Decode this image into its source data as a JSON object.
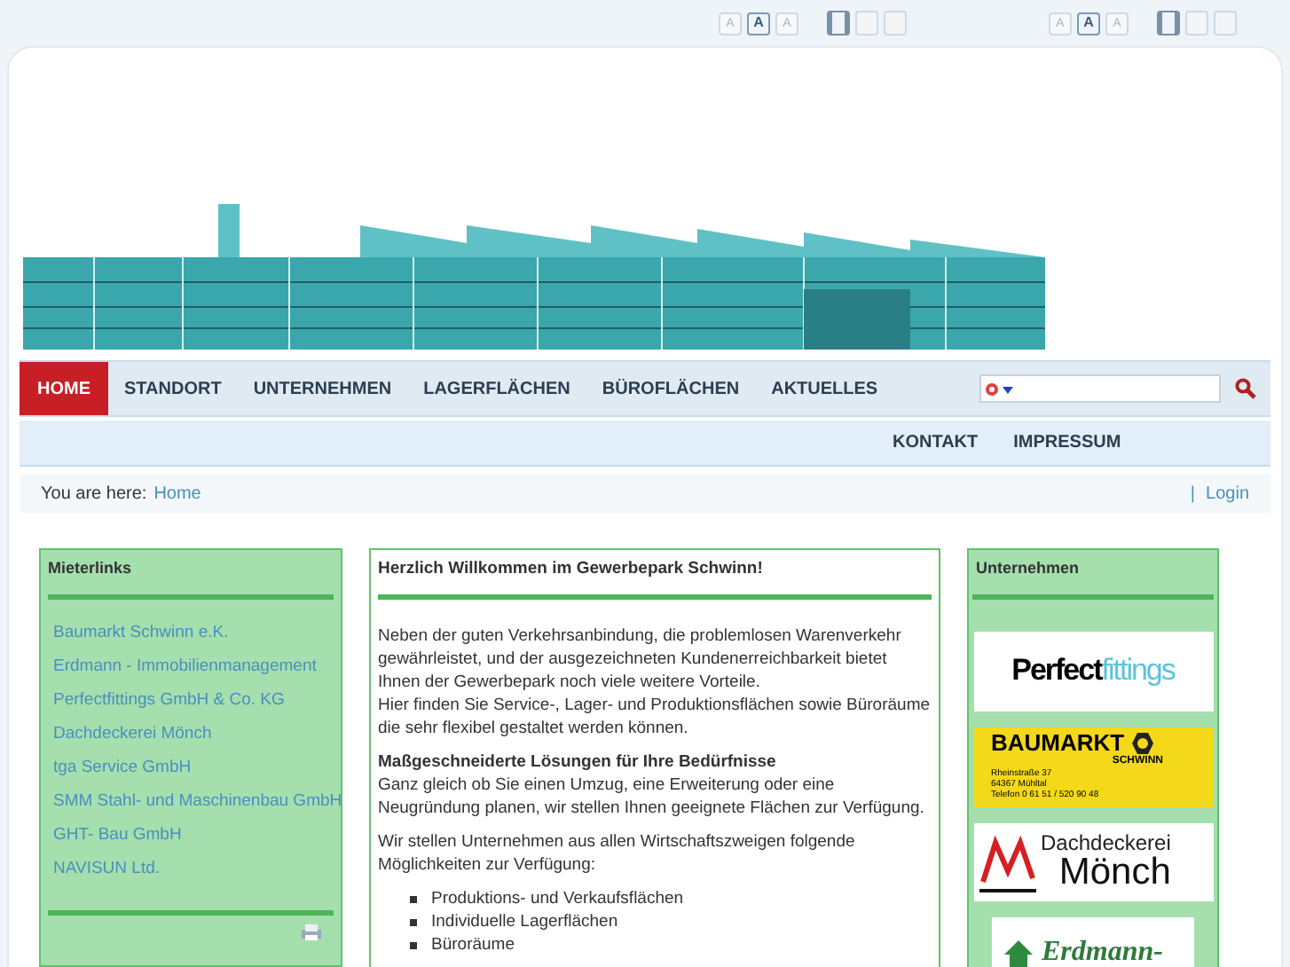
{
  "accessibility_bars": [
    {
      "font_sizes": [
        {
          "label": "A",
          "selected": false
        },
        {
          "label": "A",
          "selected": true
        },
        {
          "label": "A",
          "selected": false
        }
      ],
      "widths": [
        {
          "selected": true
        },
        {
          "selected": false
        },
        {
          "selected": false
        }
      ]
    },
    {
      "font_sizes": [
        {
          "label": "A",
          "selected": false
        },
        {
          "label": "A",
          "selected": true
        },
        {
          "label": "A",
          "selected": false
        }
      ],
      "widths": [
        {
          "selected": true
        },
        {
          "selected": false
        },
        {
          "selected": false
        }
      ]
    }
  ],
  "main_nav": [
    {
      "label": "HOME",
      "selected": true
    },
    {
      "label": "STANDORT",
      "selected": false
    },
    {
      "label": "UNTERNEHMEN",
      "selected": false
    },
    {
      "label": "LAGERFLÄCHEN",
      "selected": false
    },
    {
      "label": "BÜROFLÄCHEN",
      "selected": false
    },
    {
      "label": "AKTUELLES",
      "selected": false
    }
  ],
  "secondary_nav": [
    "KONTAKT",
    "IMPRESSUM"
  ],
  "breadcrumb": {
    "label": "You are here:",
    "items": [
      "Home"
    ]
  },
  "login": {
    "separator": "|",
    "label": "Login"
  },
  "left_module": {
    "title": "Mieterlinks",
    "links": [
      "Baumarkt Schwinn e.K.",
      "Erdmann - Immobilienmanagement",
      "Perfectfittings GmbH & Co. KG",
      "Dachdeckerei Mönch",
      "tga Service GmbH",
      "SMM Stahl- und Maschinenbau GmbH",
      "GHT- Bau GmbH",
      "NAVISUN Ltd."
    ]
  },
  "content": {
    "title": "Herzlich Willkommen im Gewerbepark Schwinn!",
    "paragraphs": [
      "Neben der guten Verkehrsanbindung, die problemlosen Warenverkehr gewährleistet, und der ausgezeichneten Kundenerreichbarkeit bietet Ihnen der Gewerbepark noch viele weitere Vorteile.\nHier finden Sie Service-, Lager- und Produktionsflächen sowie Büroräume die sehr flexibel gestaltet werden können.",
      "**Maßgeschneiderte Lösungen für Ihre Bedürfnisse**\nGanz gleich ob Sie einen Umzug, eine Erweiterung oder eine Neugründung planen, wir stellen Ihnen geeignete Flächen zur Verfügung.",
      "Wir stellen Unternehmen aus allen Wirtschaftszweigen folgende Möglichkeiten zur Verfügung:"
    ],
    "list": [
      "Produktions- und Verkaufsflächen",
      "Individuelle Lagerflächen",
      "Büroräume"
    ]
  },
  "right_module": {
    "title": "Unternehmen",
    "logos": [
      {
        "kind": "fittings",
        "texts": [
          "Perfect",
          "fittings"
        ]
      },
      {
        "kind": "baumarkt",
        "texts": [
          "BAUMARKT",
          "SCHWINN",
          "Rheinstraße 37",
          "64367 Mühltal",
          "Telefon 0 61 51 / 520 90 48"
        ]
      },
      {
        "kind": "roofer",
        "texts": [
          "Dachdeckerei",
          "Mönch"
        ]
      },
      {
        "kind": "erdmann",
        "texts": [
          "Erdmann-"
        ]
      }
    ]
  }
}
